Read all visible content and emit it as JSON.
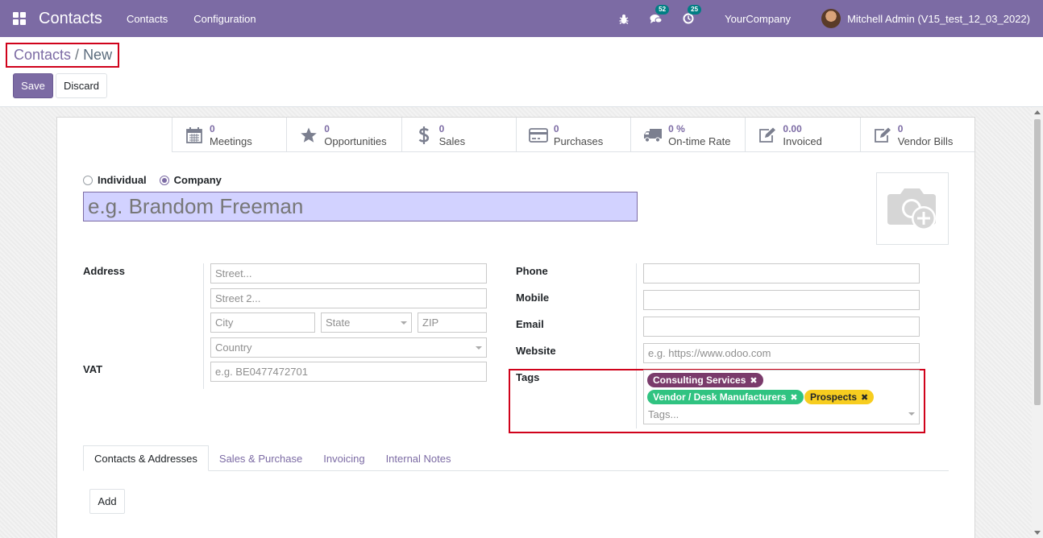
{
  "navbar": {
    "app_name": "Contacts",
    "menu": [
      "Contacts",
      "Configuration"
    ],
    "messages_count": "52",
    "activities_count": "25",
    "company": "YourCompany",
    "user": "Mitchell Admin (V15_test_12_03_2022)",
    "bg_color": "#7c6ba4"
  },
  "breadcrumb": {
    "parent": "Contacts",
    "separator": "/",
    "current": "New"
  },
  "buttons": {
    "save": "Save",
    "discard": "Discard",
    "add": "Add"
  },
  "smart_buttons": [
    {
      "value": "0",
      "label": "Meetings",
      "icon": "calendar-icon"
    },
    {
      "value": "0",
      "label": "Opportunities",
      "icon": "star-icon"
    },
    {
      "value": "0",
      "label": "Sales",
      "icon": "dollar-icon"
    },
    {
      "value": "0",
      "label": "Purchases",
      "icon": "credit-card-icon"
    },
    {
      "value": "0 %",
      "label": "On-time Rate",
      "icon": "truck-icon"
    },
    {
      "value": "0.00",
      "label": "Invoiced",
      "icon": "edit-icon"
    },
    {
      "value": "0",
      "label": "Vendor Bills",
      "icon": "edit-icon"
    }
  ],
  "company_type": {
    "individual": "Individual",
    "company": "Company",
    "selected": "Company"
  },
  "name_placeholder": "e.g. Brandom Freeman",
  "address": {
    "label": "Address",
    "street": "Street...",
    "street2": "Street 2...",
    "city": "City",
    "state": "State",
    "zip": "ZIP",
    "country": "Country"
  },
  "vat": {
    "label": "VAT",
    "placeholder": "e.g. BE0477472701"
  },
  "contact": {
    "phone": "Phone",
    "mobile": "Mobile",
    "email": "Email",
    "website": "Website",
    "website_placeholder": "e.g. https://www.odoo.com"
  },
  "tags": {
    "label": "Tags",
    "placeholder": "Tags...",
    "items": [
      {
        "name": "Consulting Services",
        "color": "#7a3b6b"
      },
      {
        "name": "Vendor / Desk Manufacturers",
        "color": "#30c381"
      },
      {
        "name": "Prospects",
        "color": "#f7cd1f"
      }
    ]
  },
  "tabs": [
    "Contacts & Addresses",
    "Sales & Purchase",
    "Invoicing",
    "Internal Notes"
  ]
}
